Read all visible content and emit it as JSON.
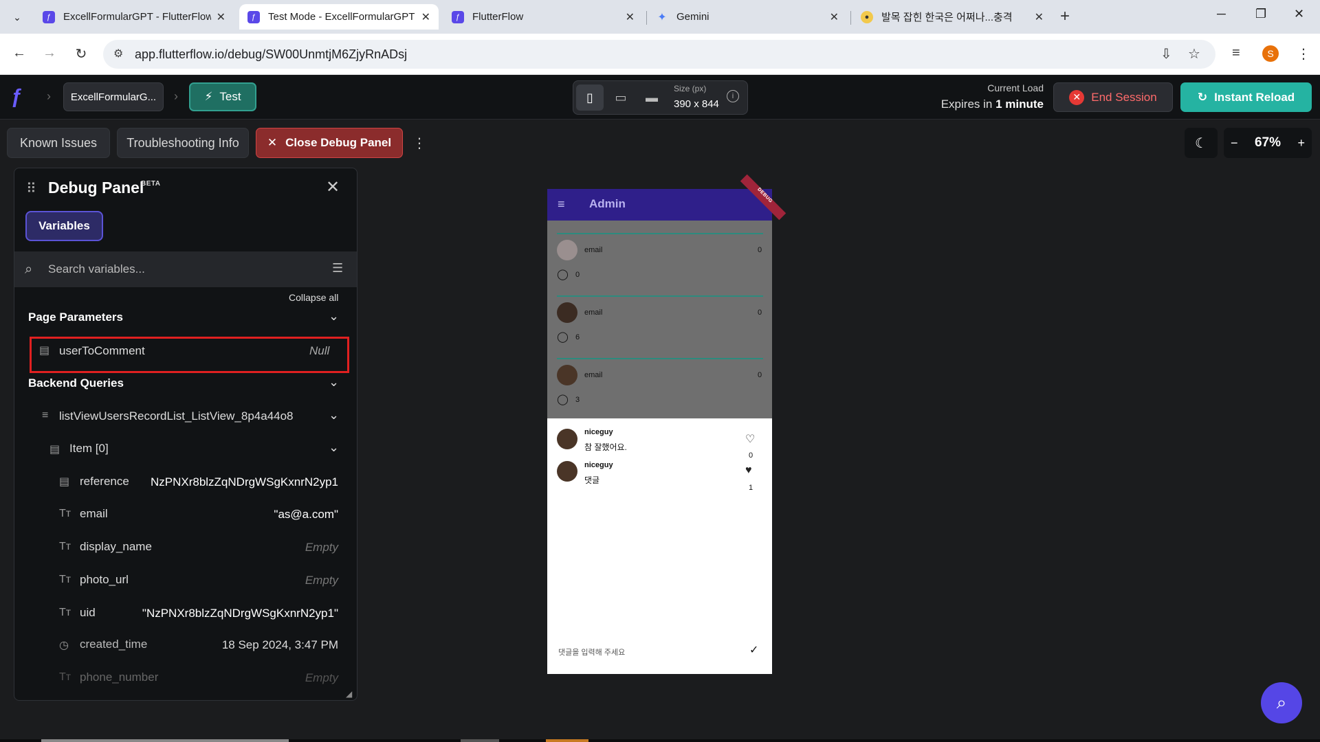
{
  "browser": {
    "tabs": [
      {
        "title": "ExcellFormularGPT - FlutterFlow",
        "active": false
      },
      {
        "title": "Test Mode - ExcellFormularGPT",
        "active": true
      },
      {
        "title": "FlutterFlow",
        "active": false
      },
      {
        "title": "Gemini",
        "active": false
      },
      {
        "title": "발목 잡힌 한국은 어쩌나...충격",
        "active": false
      }
    ],
    "url": "app.flutterflow.io/debug/SW00UnmtjM6ZjyRnADsj",
    "profile_initial": "S"
  },
  "ff_toolbar": {
    "project": "ExcellFormularG...",
    "test_label": "Test",
    "size_label": "Size (px)",
    "size_value": "390 x 844",
    "current_load_label": "Current Load",
    "expires_prefix": "Expires in",
    "expires_value": "1 minute",
    "end_session": "End Session",
    "instant_reload": "Instant Reload"
  },
  "secondary_toolbar": {
    "known_issues": "Known Issues",
    "troubleshooting": "Troubleshooting Info",
    "close_debug": "Close Debug Panel",
    "zoom": "67%"
  },
  "debug_panel": {
    "title": "Debug Panel",
    "beta": "BETA",
    "tab": "Variables",
    "search_placeholder": "Search variables...",
    "collapse_all": "Collapse all",
    "page_params_title": "Page Parameters",
    "page_param": {
      "name": "userToComment",
      "value": "Null"
    },
    "backend_title": "Backend Queries",
    "query_name": "listViewUsersRecordList_ListView_8p4a44o8",
    "item_label": "Item [0]",
    "fields": [
      {
        "key": "reference",
        "value": "NzPNXr8blzZqNDrgWSgKxnrN2yp1",
        "empty": false
      },
      {
        "key": "email",
        "value": "\"as@a.com\"",
        "empty": false
      },
      {
        "key": "display_name",
        "value": "Empty",
        "empty": true
      },
      {
        "key": "photo_url",
        "value": "Empty",
        "empty": true
      },
      {
        "key": "uid",
        "value": "\"NzPNXr8blzZqNDrgWSgKxnrN2yp1\"",
        "empty": false
      },
      {
        "key": "created_time",
        "value": "18 Sep 2024, 3:47 PM",
        "empty": false
      },
      {
        "key": "phone_number",
        "value": "Empty",
        "empty": true
      }
    ]
  },
  "phone": {
    "appbar_title": "Admin",
    "debug_ribbon": "DEBUG",
    "users": [
      {
        "email": "email",
        "count": "0",
        "comments": "0"
      },
      {
        "email": "email",
        "count": "0",
        "comments": "6"
      },
      {
        "email": "email",
        "count": "0",
        "comments": "3"
      }
    ],
    "comments": [
      {
        "name": "niceguy",
        "text": "참 잘했어요.",
        "likes": "0",
        "liked": false
      },
      {
        "name": "niceguy",
        "text": "댓글",
        "likes": "1",
        "liked": true
      }
    ],
    "input_placeholder": "댓글을 입력해 주세요"
  }
}
